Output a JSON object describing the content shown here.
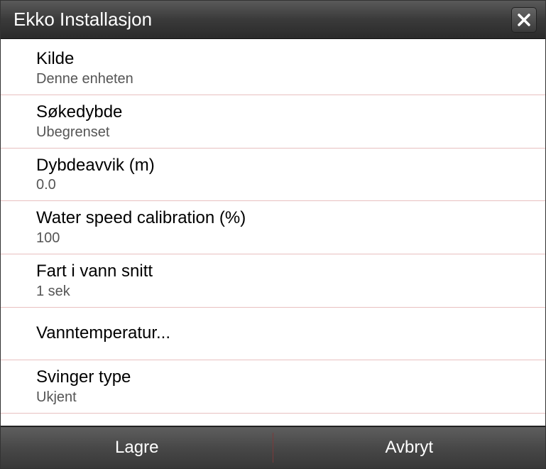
{
  "header": {
    "title": "Ekko Installasjon"
  },
  "items": [
    {
      "label": "Kilde",
      "value": "Denne enheten"
    },
    {
      "label": "Søkedybde",
      "value": "Ubegrenset"
    },
    {
      "label": "Dybdeavvik (m)",
      "value": "0.0"
    },
    {
      "label": "Water speed calibration (%)",
      "value": "100"
    },
    {
      "label": "Fart i vann snitt",
      "value": "1 sek"
    },
    {
      "label": "Vanntemperatur...",
      "value": null
    },
    {
      "label": "Svinger type",
      "value": "Ukjent"
    }
  ],
  "footer": {
    "save": "Lagre",
    "cancel": "Avbryt"
  }
}
